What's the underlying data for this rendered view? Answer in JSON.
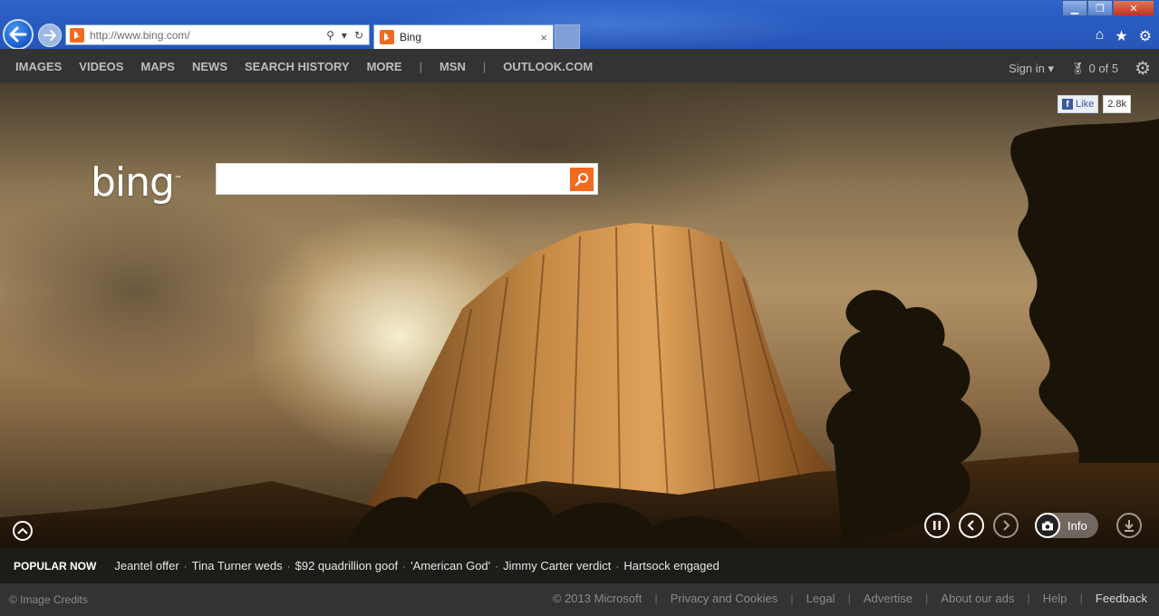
{
  "browser": {
    "url": "http://www.bing.com/",
    "tab_title": "Bing",
    "tab_close": "×"
  },
  "nav": {
    "left": [
      "IMAGES",
      "VIDEOS",
      "MAPS",
      "NEWS",
      "SEARCH HISTORY",
      "MORE"
    ],
    "sep": "|",
    "msn": "MSN",
    "outlook": "OUTLOOK.COM",
    "signin": "Sign in",
    "rewards": "0 of 5"
  },
  "hero": {
    "logo": "bing",
    "logo_tm": "™",
    "search_value": "",
    "fb_like": "Like",
    "fb_count": "2.8k",
    "info_label": "Info"
  },
  "popular": {
    "heading": "POPULAR NOW",
    "items": [
      "Jeantel offer",
      "Tina Turner weds",
      "$92 quadrillion goof",
      "'American God'",
      "Jimmy Carter verdict",
      "Hartsock engaged"
    ]
  },
  "footer": {
    "credits": "© Image Credits",
    "copyright": "© 2013 Microsoft",
    "links": [
      "Privacy and Cookies",
      "Legal",
      "Advertise",
      "About our ads",
      "Help"
    ],
    "feedback": "Feedback"
  },
  "colors": {
    "bing_orange": "#f26b1d",
    "nav_bg": "#333333",
    "ie_blue": "#2a5cc0"
  }
}
